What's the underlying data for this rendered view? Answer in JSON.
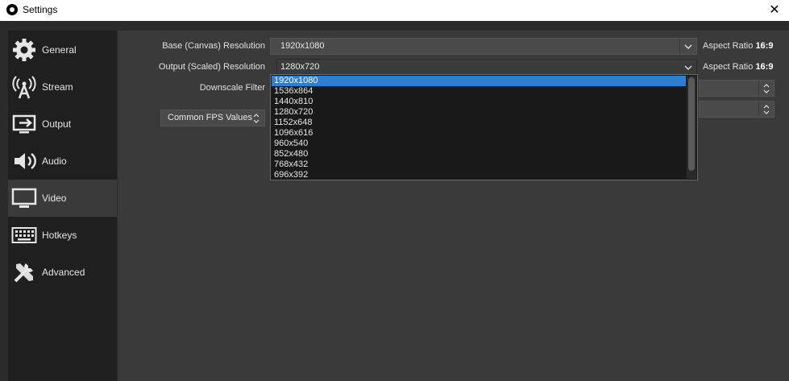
{
  "window": {
    "title": "Settings",
    "close_glyph": "✕"
  },
  "sidebar": {
    "items": [
      {
        "label": "General",
        "icon": "gear-icon",
        "active": false
      },
      {
        "label": "Stream",
        "icon": "broadcast-antenna-icon",
        "active": false
      },
      {
        "label": "Output",
        "icon": "output-screen-icon",
        "active": false
      },
      {
        "label": "Audio",
        "icon": "speaker-icon",
        "active": false
      },
      {
        "label": "Video",
        "icon": "monitor-icon",
        "active": true
      },
      {
        "label": "Hotkeys",
        "icon": "keyboard-icon",
        "active": false
      },
      {
        "label": "Advanced",
        "icon": "tools-icon",
        "active": false
      }
    ]
  },
  "video": {
    "base_resolution": {
      "label": "Base (Canvas) Resolution",
      "value": "1920x1080",
      "aspect_label": "Aspect Ratio",
      "aspect_value": "16:9"
    },
    "output_resolution": {
      "label": "Output (Scaled) Resolution",
      "value": "1280x720",
      "aspect_label": "Aspect Ratio",
      "aspect_value": "16:9"
    },
    "downscale_filter": {
      "label": "Downscale Filter"
    },
    "fps": {
      "label": "Common FPS Values"
    }
  },
  "dropdown": {
    "selected_index": 0,
    "options": [
      "1920x1080",
      "1536x864",
      "1440x810",
      "1280x720",
      "1152x648",
      "1096x616",
      "960x540",
      "852x480",
      "768x432",
      "696x392"
    ]
  },
  "colors": {
    "accent": "#2f7fd0",
    "sidebar_bg": "#1f1f1f",
    "content_bg": "#3a3a3a"
  }
}
